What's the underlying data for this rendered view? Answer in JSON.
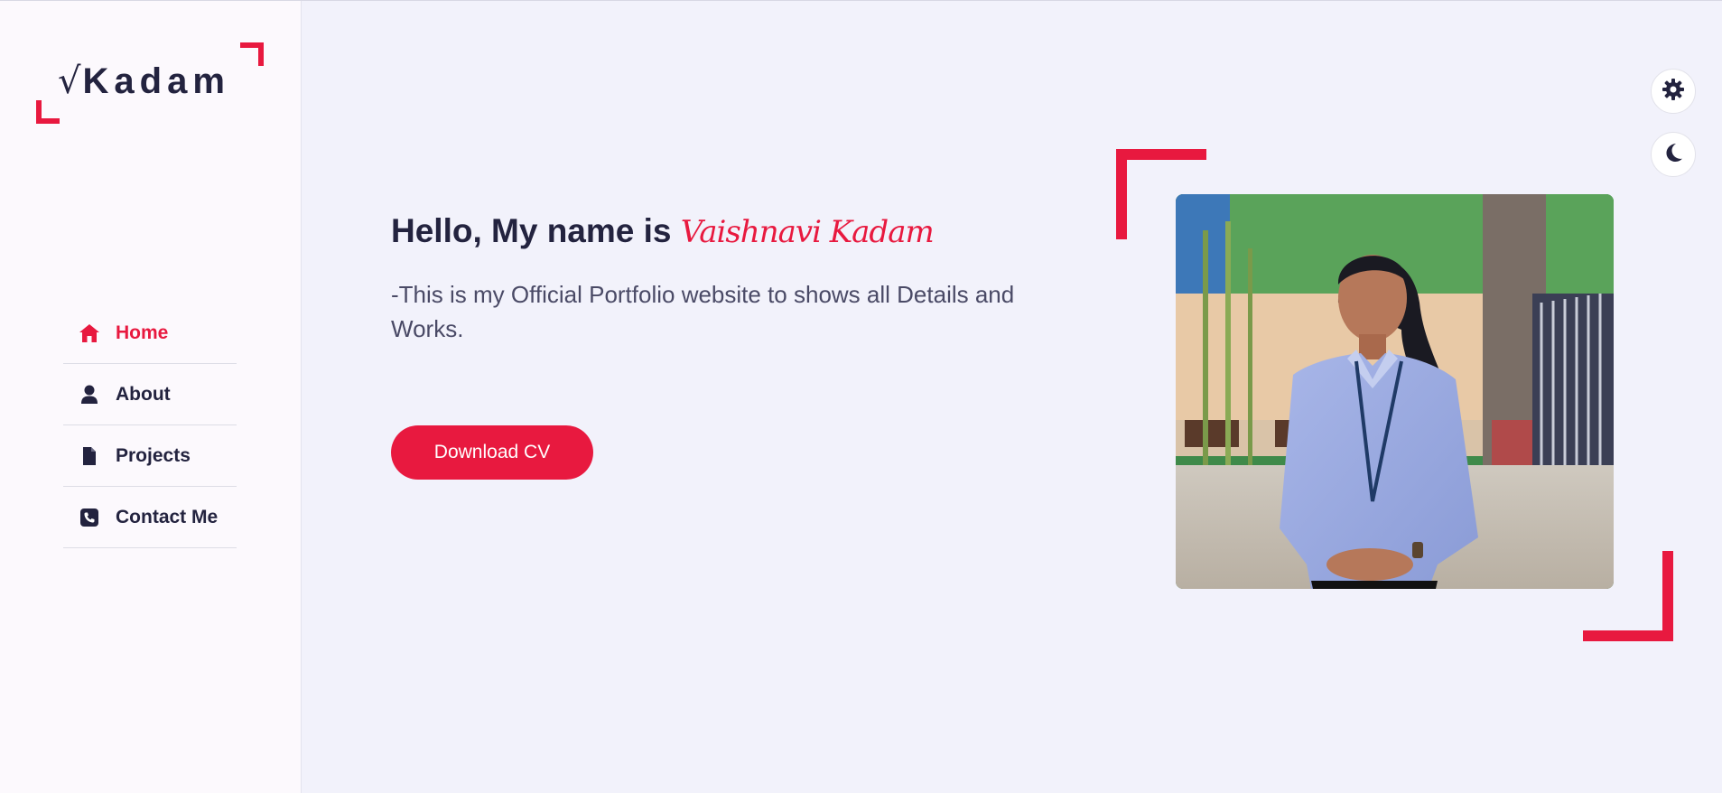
{
  "logo": {
    "mark": "√",
    "text": "Kadam"
  },
  "nav": {
    "items": [
      {
        "label": "Home",
        "icon": "home-icon",
        "active": true
      },
      {
        "label": "About",
        "icon": "user-icon",
        "active": false
      },
      {
        "label": "Projects",
        "icon": "file-icon",
        "active": false
      },
      {
        "label": "Contact Me",
        "icon": "phone-icon",
        "active": false
      }
    ]
  },
  "hero": {
    "greeting": "Hello, My name is",
    "name": "Vaishnavi Kadam",
    "description": "-This is my Official Portfolio website to shows all Details and Works.",
    "download_label": "Download CV"
  },
  "controls": {
    "settings_icon": "gear-icon",
    "theme_icon": "moon-icon"
  },
  "colors": {
    "accent": "#e8193f",
    "text_dark": "#23233f",
    "background": "#f2f2fb",
    "sidebar": "#fcf9fd"
  }
}
